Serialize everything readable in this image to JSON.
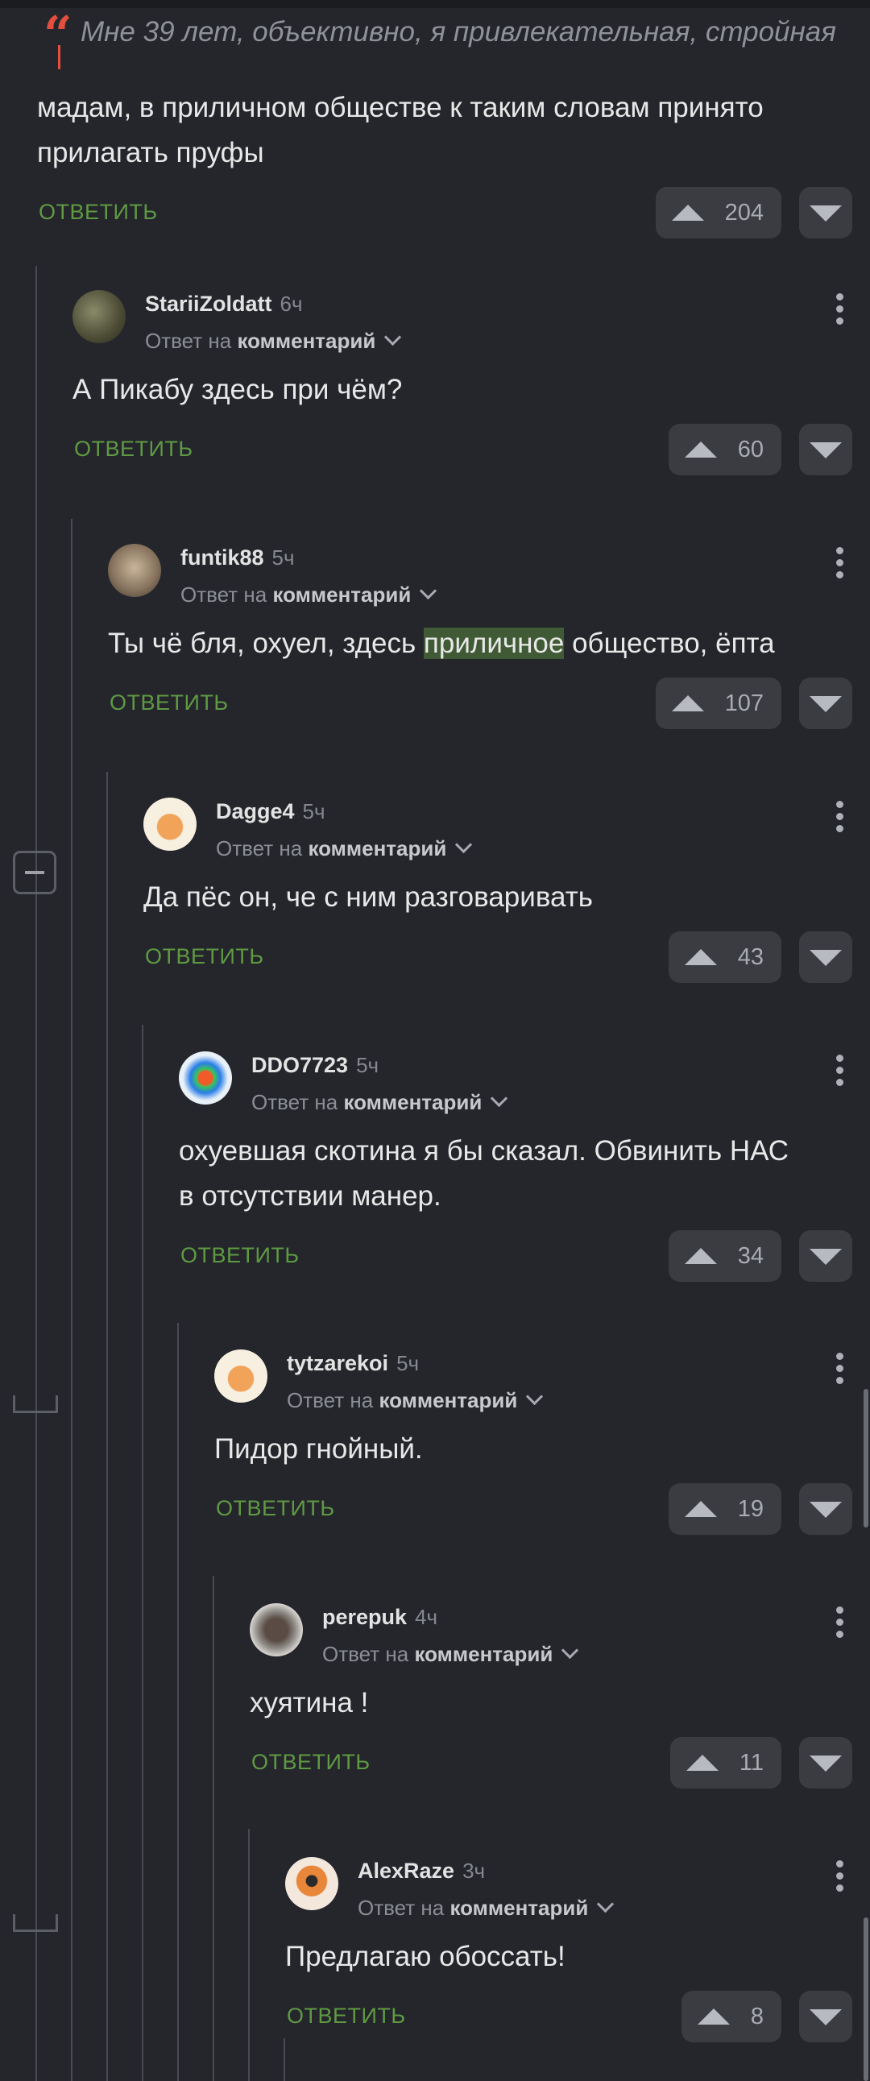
{
  "quote": {
    "text": "Мне 39 лет, объективно, я привлекательная, стройная"
  },
  "comments": [
    {
      "user": "",
      "time": "",
      "reply_prefix": "",
      "reply_target": "",
      "body_lines": [
        "мадам, в приличном обществе к таким словам принято",
        "прилагать пруфы"
      ],
      "reply_label": "ОТВЕТИТЬ",
      "votes": "204"
    },
    {
      "user": "StariiZoldatt",
      "time": "6ч",
      "reply_prefix": "Ответ на",
      "reply_target": "комментарий",
      "body_lines": [
        "А Пикабу здесь при чём?"
      ],
      "reply_label": "ОТВЕТИТЬ",
      "votes": "60"
    },
    {
      "user": "funtik88",
      "time": "5ч",
      "reply_prefix": "Ответ на",
      "reply_target": "комментарий",
      "body_before": "Ты чё бля, охуел, здесь ",
      "body_highlight": "приличное",
      "body_after": " общество, ёпта",
      "reply_label": "ОТВЕТИТЬ",
      "votes": "107"
    },
    {
      "user": "Dagge4",
      "time": "5ч",
      "reply_prefix": "Ответ на",
      "reply_target": "комментарий",
      "body_lines": [
        "Да пёс он, че с ним разговаривать"
      ],
      "reply_label": "ОТВЕТИТЬ",
      "votes": "43"
    },
    {
      "user": "DDO7723",
      "time": "5ч",
      "reply_prefix": "Ответ на",
      "reply_target": "комментарий",
      "body_lines": [
        "охуевшая скотина я бы сказал. Обвинить НАС",
        "в отсутствии манер."
      ],
      "reply_label": "ОТВЕТИТЬ",
      "votes": "34"
    },
    {
      "user": "tytzarekoi",
      "time": "5ч",
      "reply_prefix": "Ответ на",
      "reply_target": "комментарий",
      "body_lines": [
        "Пидор гнойный."
      ],
      "reply_label": "ОТВЕТИТЬ",
      "votes": "19"
    },
    {
      "user": "perepuk",
      "time": "4ч",
      "reply_prefix": "Ответ на",
      "reply_target": "комментарий",
      "body_lines": [
        "хуятина !"
      ],
      "reply_label": "ОТВЕТИТЬ",
      "votes": "11"
    },
    {
      "user": "AlexRaze",
      "time": "3ч",
      "reply_prefix": "Ответ на",
      "reply_target": "комментарий",
      "body_lines": [
        "Предлагаю обоссать!"
      ],
      "reply_label": "ОТВЕТИТЬ",
      "votes": "8"
    }
  ],
  "colors": {
    "background": "#24262b",
    "accent_green": "#5f9a43",
    "quote_red": "#e24e3f",
    "highlight": "#3f5a34"
  },
  "icons": {
    "upvote": "arrow-up-icon",
    "downvote": "arrow-down-icon",
    "more": "more-vertical-icon",
    "expand": "chevron-down-icon",
    "collapse": "minus-icon"
  }
}
